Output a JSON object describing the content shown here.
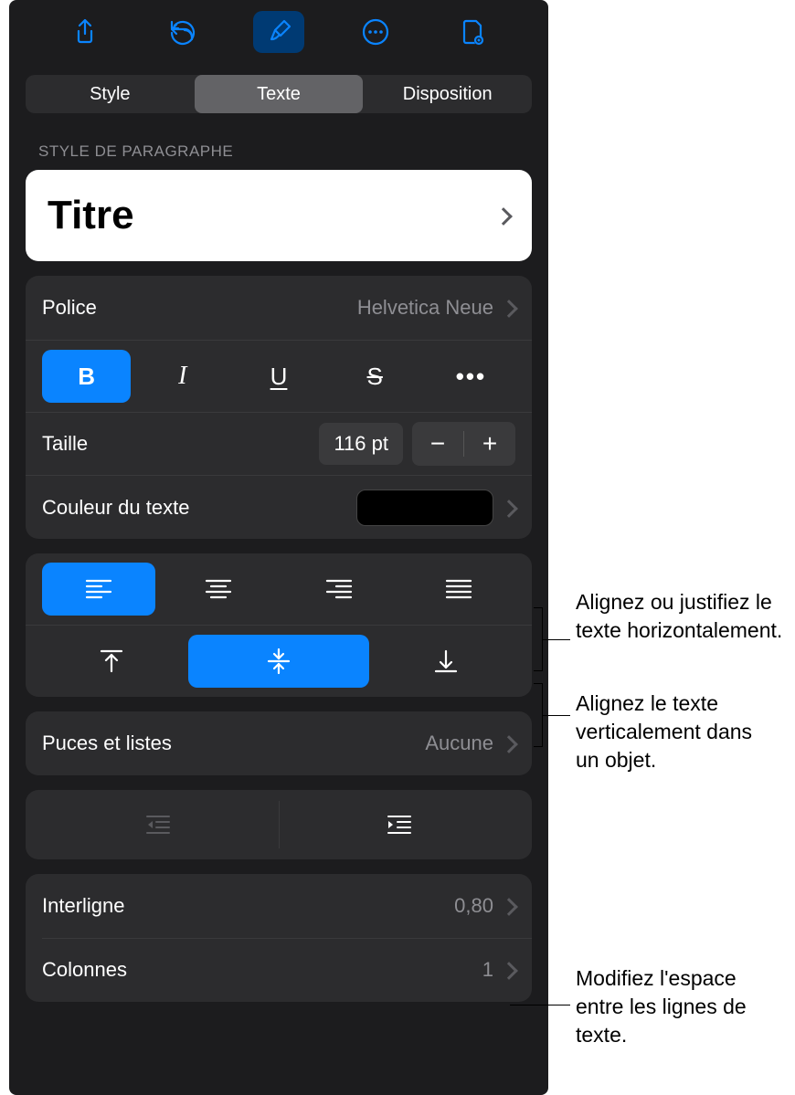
{
  "toolbar": {
    "share": "share-icon",
    "undo": "undo-icon",
    "format": "format-brush-icon",
    "more": "more-icon",
    "document": "document-icon"
  },
  "segments": {
    "style": "Style",
    "text": "Texte",
    "layout": "Disposition"
  },
  "paragraph": {
    "section_label": "STYLE DE PARAGRAPHE",
    "style_name": "Titre"
  },
  "font": {
    "label": "Police",
    "value": "Helvetica Neue",
    "bold": "B",
    "italic": "I",
    "underline": "U",
    "strike": "S",
    "more": "•••",
    "size_label": "Taille",
    "size_value": "116 pt",
    "color_label": "Couleur du texte"
  },
  "bullets": {
    "label": "Puces et listes",
    "value": "Aucune"
  },
  "spacing": {
    "line_label": "Interligne",
    "line_value": "0,80",
    "columns_label": "Colonnes",
    "columns_value": "1"
  },
  "callouts": {
    "halign": "Alignez ou justifiez le texte horizontalement.",
    "valign": "Alignez le texte verticalement dans un objet.",
    "linespace": "Modifiez l'espace entre les lignes de texte."
  }
}
